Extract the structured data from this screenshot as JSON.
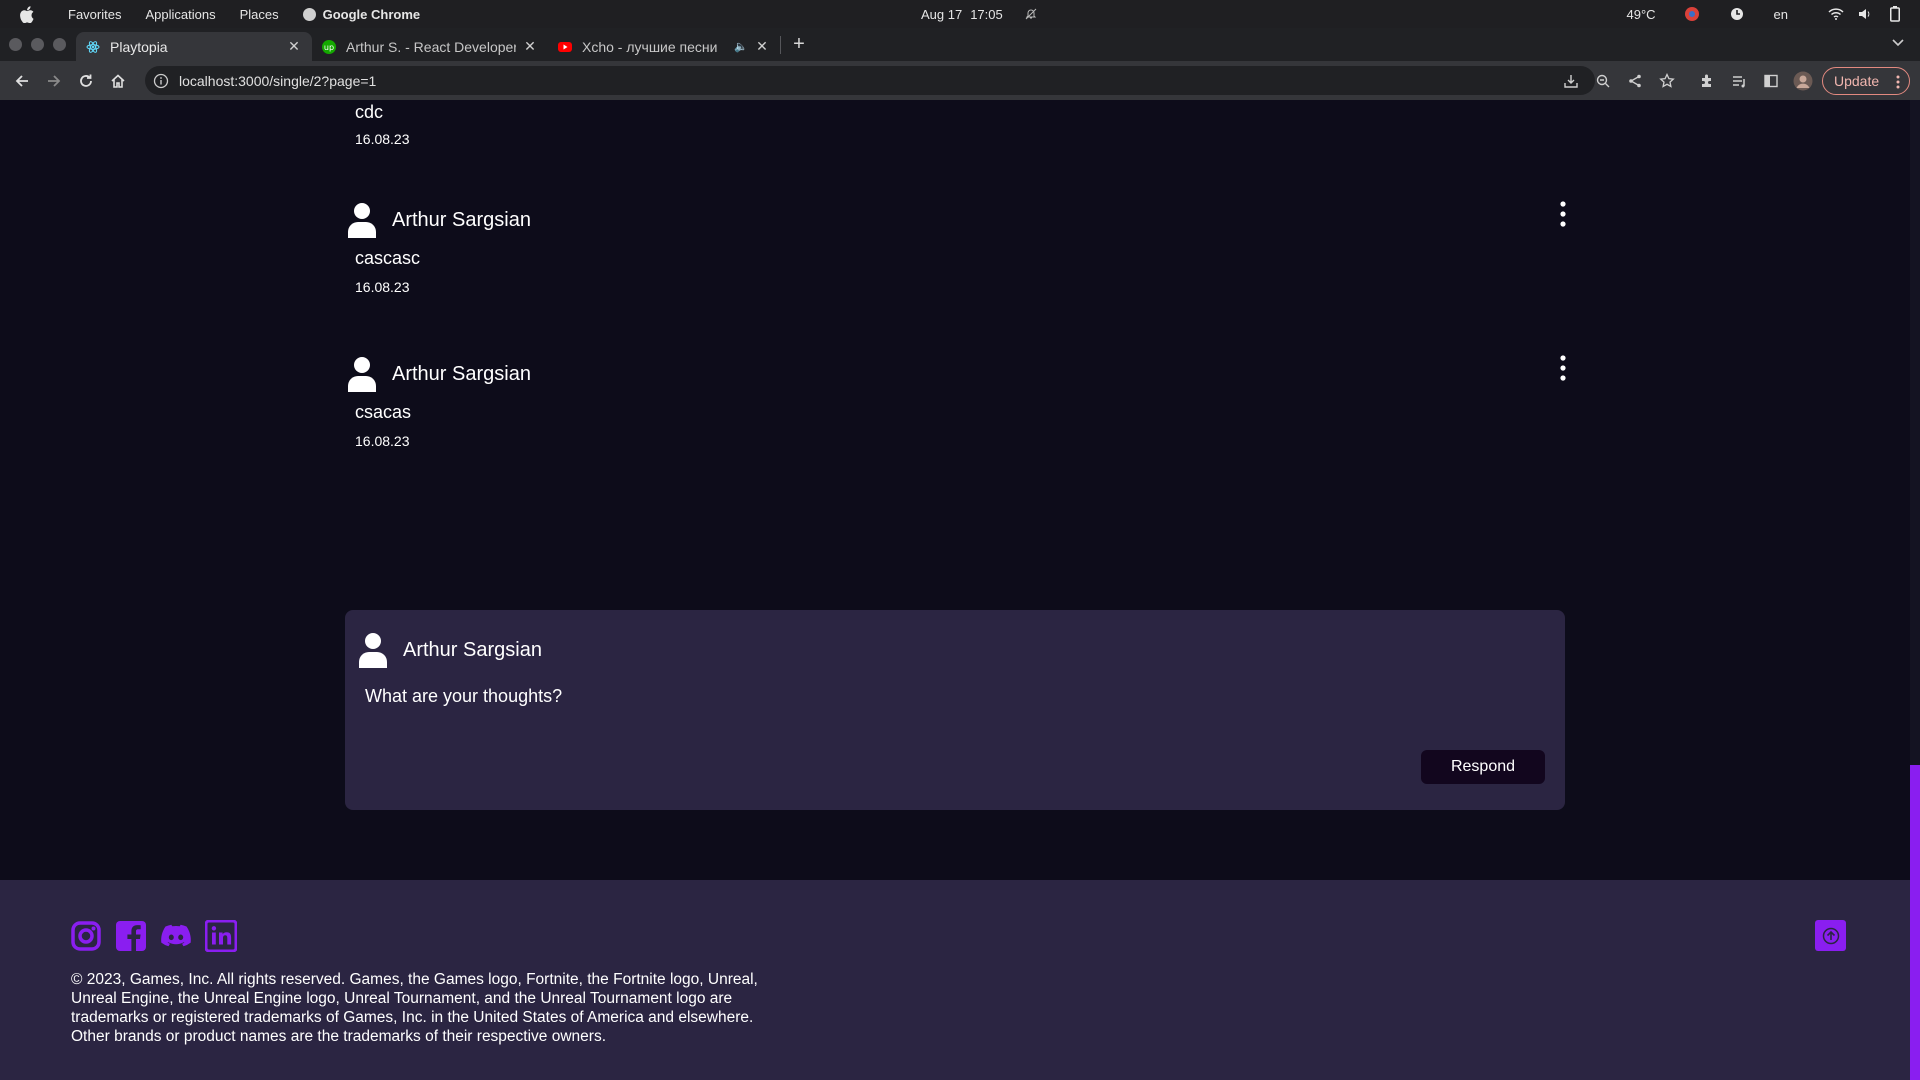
{
  "os_bar": {
    "menu": [
      "Favorites",
      "Applications",
      "Places"
    ],
    "app_name": "Google Chrome",
    "date": "Aug 17",
    "time": "17:05",
    "temperature": "49°C",
    "language": "en"
  },
  "browser": {
    "tabs": [
      {
        "title": "Playtopia",
        "active": true
      },
      {
        "title": "Arthur S. - React Developer",
        "active": false
      },
      {
        "title": "Xcho - лучшие песни",
        "active": false
      }
    ],
    "url": "localhost:3000/single/2?page=1",
    "update_label": "Update"
  },
  "comments": [
    {
      "author": "",
      "text": "cdc",
      "date": "16.08.23"
    },
    {
      "author": "Arthur Sargsian",
      "text": "cascasc",
      "date": "16.08.23"
    },
    {
      "author": "Arthur Sargsian",
      "text": "csacas",
      "date": "16.08.23"
    }
  ],
  "respond": {
    "author": "Arthur Sargsian",
    "placeholder": "What are your thoughts?",
    "button_label": "Respond"
  },
  "footer": {
    "social_icons": [
      "instagram-icon",
      "facebook-icon",
      "discord-icon",
      "linkedin-icon"
    ],
    "copyright": "© 2023, Games, Inc. All rights reserved. Games, the Games logo, Fortnite, the Fortnite logo, Unreal, Unreal Engine, the Unreal Engine logo, Unreal Tournament, and the Unreal Tournament logo are trademarks or registered trademarks of Games, Inc. in the United States of America and elsewhere. Other brands or product names are the trademarks of their respective owners."
  },
  "colors": {
    "page_bg": "#0d0c1a",
    "card_bg": "#2b2542",
    "accent": "#8a1ef0"
  }
}
